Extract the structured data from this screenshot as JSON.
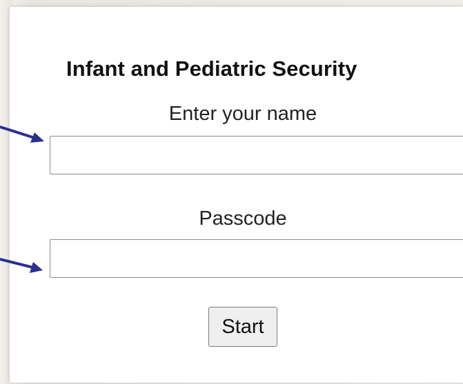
{
  "form": {
    "title": "Infant and Pediatric Security",
    "name_label": "Enter your name",
    "name_value": "",
    "passcode_label": "Passcode",
    "passcode_value": "",
    "start_label": "Start"
  },
  "colors": {
    "arrow": "#2b2f8f",
    "panel_background": "#ffffff",
    "page_background": "#ece9e4"
  },
  "icons": {
    "pointer_arrows": [
      "arrow-right-icon",
      "arrow-right-icon"
    ]
  }
}
